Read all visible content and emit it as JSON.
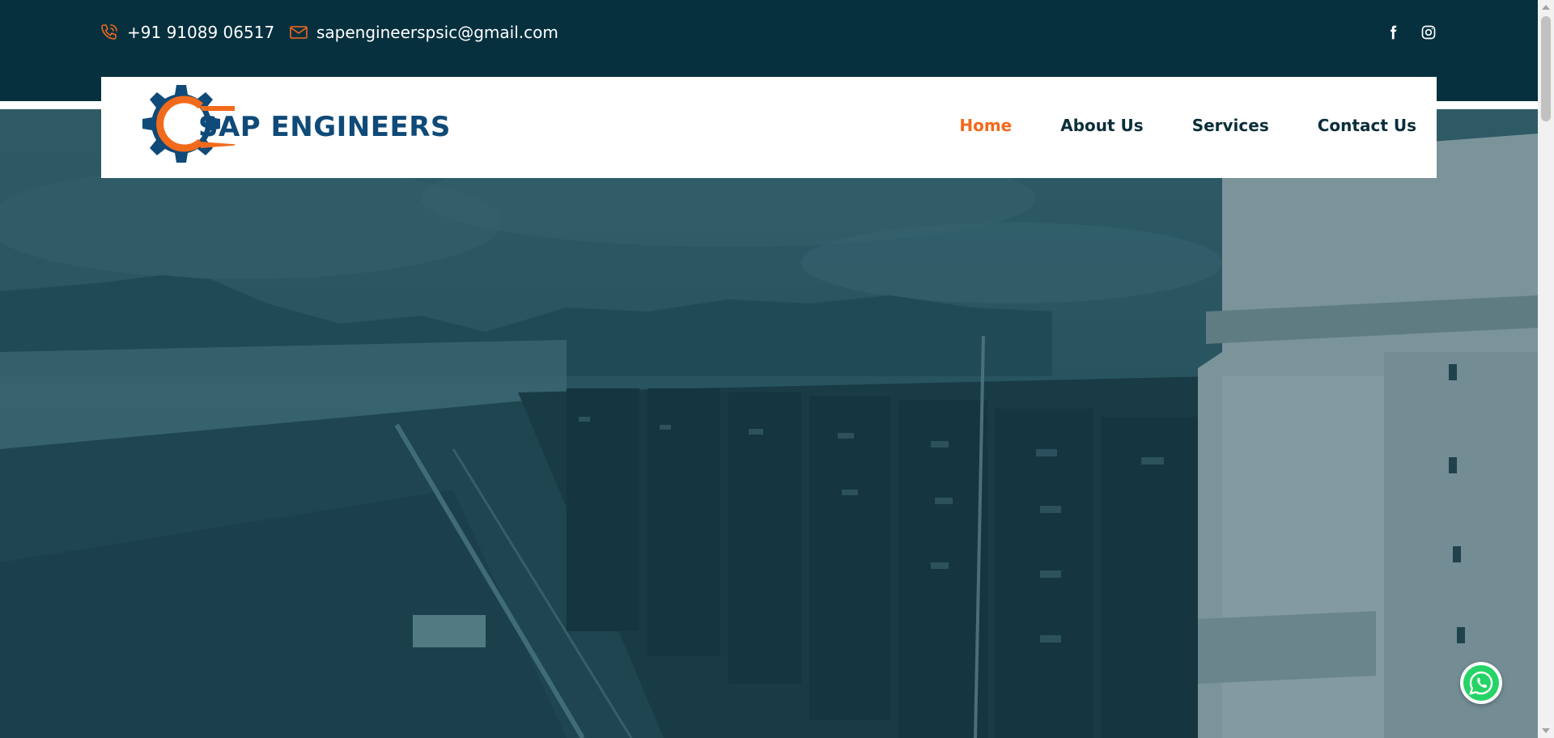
{
  "topbar": {
    "phone_icon": "phone-icon",
    "phone": "+91 91089 06517",
    "email_icon": "mail-icon",
    "email": "sapengineerspsic@gmail.com",
    "social": [
      "facebook-icon",
      "instagram-icon"
    ]
  },
  "header": {
    "logo_text": "SAP ENGINEERS",
    "nav": [
      {
        "label": "Home",
        "active": true
      },
      {
        "label": "About Us",
        "active": false
      },
      {
        "label": "Services",
        "active": false
      },
      {
        "label": "Contact Us",
        "active": false
      }
    ]
  },
  "colors": {
    "topbar_bg": "#06303e",
    "accent": "#f26a1b",
    "brand_blue": "#0f4a78",
    "nav_text": "#0b2e3a",
    "whatsapp_green": "#25d366"
  },
  "floating": {
    "whatsapp_icon": "whatsapp-icon"
  }
}
